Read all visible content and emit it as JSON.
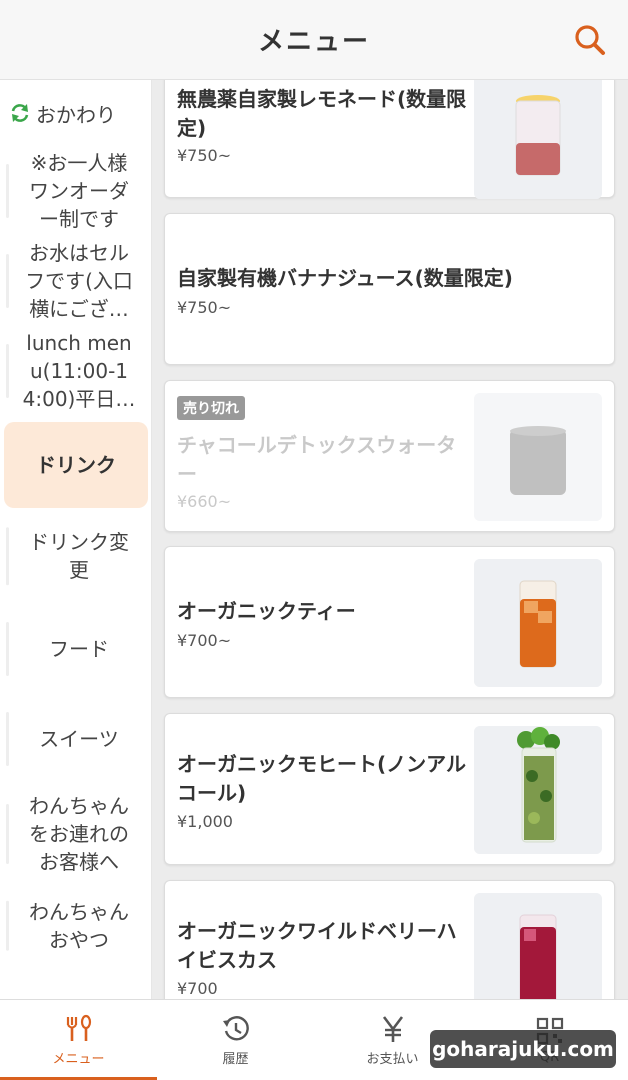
{
  "header": {
    "title": "メニュー"
  },
  "sidebar": {
    "refill_label": "おかわり",
    "items": [
      {
        "label": "※お一人様ワンオーダー制です"
      },
      {
        "label": "お水はセルフです(入口横にござ…"
      },
      {
        "label": "lunch menu(11:00-14:00)平日…"
      },
      {
        "label": "ドリンク"
      },
      {
        "label": "ドリンク変更"
      },
      {
        "label": "フード"
      },
      {
        "label": "スイーツ"
      },
      {
        "label": "わんちゃんをお連れのお客様へ"
      },
      {
        "label": "わんちゃんおやつ"
      }
    ]
  },
  "menu_items": [
    {
      "name": "無農薬自家製レモネード(数量限定)",
      "price": "¥750~",
      "image": "lemonade",
      "sold_out": false
    },
    {
      "name": "自家製有機バナナジュース(数量限定)",
      "price": "¥750~",
      "image": null,
      "sold_out": false
    },
    {
      "name": "チャコールデトックスウォーター",
      "price": "¥660~",
      "image": "charcoal-water",
      "sold_out": true,
      "badge": "売り切れ"
    },
    {
      "name": "オーガニックティー",
      "price": "¥700~",
      "image": "iced-tea",
      "sold_out": false
    },
    {
      "name": "オーガニックモヒート(ノンアルコール)",
      "price": "¥1,000",
      "image": "mojito",
      "sold_out": false
    },
    {
      "name": "オーガニックワイルドベリーハイビスカス",
      "price": "¥700",
      "image": "hibiscus",
      "sold_out": false
    }
  ],
  "tabs": [
    {
      "label": "メニュー",
      "icon": "fork-knife-icon",
      "active": true
    },
    {
      "label": "履歴",
      "icon": "history-icon",
      "active": false
    },
    {
      "label": "お支払い",
      "icon": "yen-icon",
      "active": false
    },
    {
      "label": "QR",
      "icon": "qr-icon",
      "active": false
    }
  ],
  "watermark": "goharajuku.com",
  "colors": {
    "accent": "#d9601e",
    "active_bg": "#fde9d8",
    "refill_icon": "#3aa64a"
  }
}
